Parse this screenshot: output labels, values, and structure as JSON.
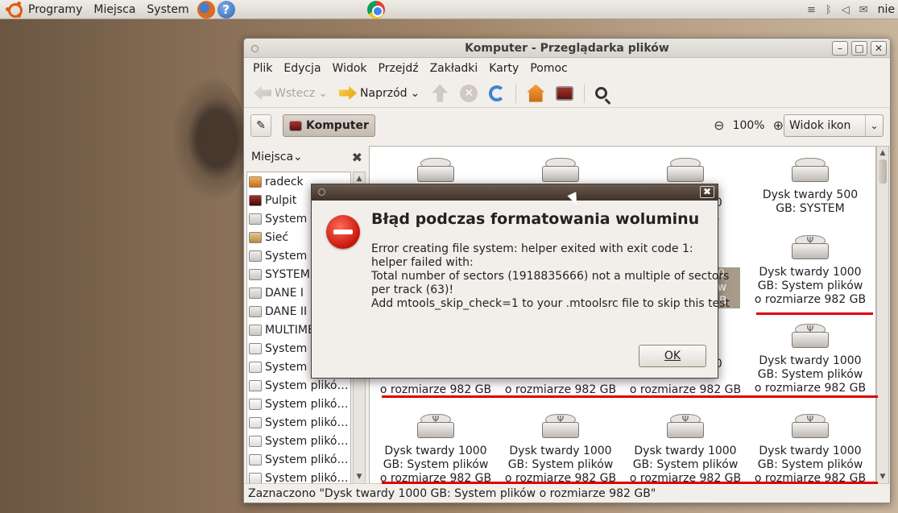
{
  "top_panel": {
    "menu": [
      "Programy",
      "Miejsca",
      "System"
    ],
    "user": "nie"
  },
  "window": {
    "title": "Komputer - Przeglądarka plików",
    "menubar": [
      "Plik",
      "Edycja",
      "Widok",
      "Przejdź",
      "Zakładki",
      "Karty",
      "Pomoc"
    ],
    "toolbar": {
      "back_label": "Wstecz",
      "forward_label": "Naprzód"
    },
    "location": {
      "path_label": "Komputer",
      "zoom": "100%",
      "view_mode": "Widok ikon"
    },
    "sidebar": {
      "header": "Miejsca",
      "items": [
        {
          "label": "radeck",
          "icon": "home"
        },
        {
          "label": "Pulpit",
          "icon": "desktop"
        },
        {
          "label": "System p",
          "icon": "drive"
        },
        {
          "label": "Sieć",
          "icon": "folder"
        },
        {
          "label": "System p",
          "icon": "drive"
        },
        {
          "label": "SYSTEM",
          "icon": "drive"
        },
        {
          "label": "DANE I",
          "icon": "drive"
        },
        {
          "label": "DANE II",
          "icon": "drive"
        },
        {
          "label": "MULTIME",
          "icon": "drive"
        },
        {
          "label": "System p",
          "icon": "usb"
        },
        {
          "label": "System p",
          "icon": "usb"
        },
        {
          "label": "System plikó…",
          "icon": "usb"
        },
        {
          "label": "System plikó…",
          "icon": "usb"
        },
        {
          "label": "System plikó…",
          "icon": "usb"
        },
        {
          "label": "System plikó…",
          "icon": "usb"
        },
        {
          "label": "System plikó…",
          "icon": "usb"
        },
        {
          "label": "System plikó…",
          "icon": "usb"
        }
      ]
    },
    "icons": {
      "row0": [
        "",
        "",
        "00\nIA",
        "Dysk twardy 500\nGB: SYSTEM"
      ],
      "row1_right": "Dysk twardy 1000\nGB: System plików\no rozmiarze 982 GB",
      "row1_partial": "00\nów\nGB",
      "row2": [
        "o rozmiarze 982 GB",
        "o rozmiarze 982 GB",
        "o rozmiarze 982 GB"
      ],
      "row2_right": "Dysk twardy 1000\nGB: System plików\no rozmiarze 982 GB",
      "row2_partial_top": "00",
      "row3": [
        "Dysk twardy 1000\nGB: System plików\no rozmiarze 982 GB",
        "Dysk twardy 1000\nGB: System plików\no rozmiarze 982 GB",
        "Dysk twardy 1000\nGB: System plików\no rozmiarze 982 GB",
        "Dysk twardy 1000\nGB: System plików\no rozmiarze 982 GB"
      ]
    },
    "status": "Zaznaczono \"Dysk twardy 1000 GB: System plików o rozmiarze 982 GB\""
  },
  "dialog": {
    "heading": "Błąd podczas formatowania woluminu",
    "message": [
      "Error creating file system: helper exited with exit code 1:",
      "helper failed with:",
      "Total number of sectors (1918835666) not a multiple of sectors",
      "per track (63)!",
      "Add mtools_skip_check=1 to your .mtoolsrc file to skip this test"
    ],
    "ok_label": "OK",
    "close_symbol": "✖"
  },
  "colors": {
    "annotation_red": "#dd0000",
    "error_red": "#c8160a",
    "selection": "#a89b8a"
  }
}
